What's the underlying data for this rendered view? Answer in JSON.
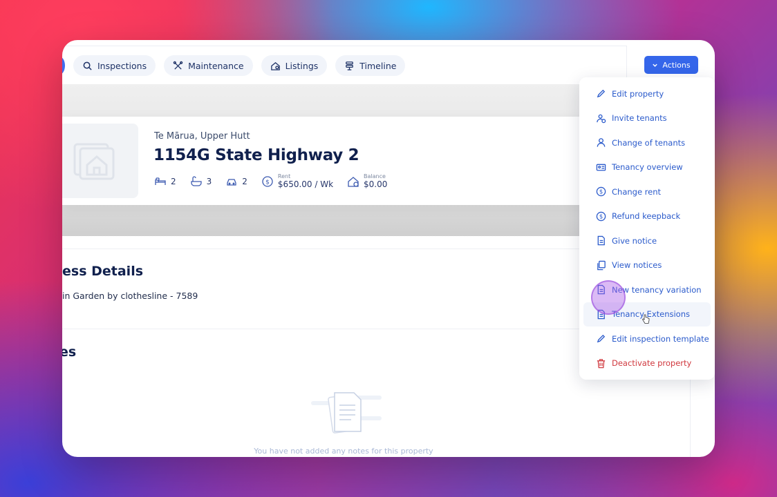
{
  "tabs": [
    {
      "label": "Inspections",
      "icon": "search-icon"
    },
    {
      "label": "Maintenance",
      "icon": "tools-icon"
    },
    {
      "label": "Listings",
      "icon": "house-search-icon"
    },
    {
      "label": "Timeline",
      "icon": "timeline-icon"
    }
  ],
  "actions": {
    "label": "Actions"
  },
  "property": {
    "suburb": "Te Mārua, Upper Hutt",
    "address": "1154G State Highway 2",
    "bedrooms": "2",
    "bathrooms": "3",
    "parking": "2",
    "rent_label": "Rent",
    "rent_value": "$650.00 / Wk",
    "balance_label": "Balance",
    "balance_value": "$0.00"
  },
  "access": {
    "title": "ess Details",
    "text": "in Garden by clothesline - 7589"
  },
  "notes": {
    "title": "es",
    "empty_text": "You have not added any notes for this property"
  },
  "menu": {
    "items": [
      {
        "label": "Edit property",
        "icon": "pencil-icon"
      },
      {
        "label": "Invite tenants",
        "icon": "user-plus-icon"
      },
      {
        "label": "Change of tenants",
        "icon": "user-icon"
      },
      {
        "label": "Tenancy overview",
        "icon": "id-card-icon"
      },
      {
        "label": "Change rent",
        "icon": "dollar-circle-icon"
      },
      {
        "label": "Refund keepback",
        "icon": "dollar-circle-icon"
      },
      {
        "label": "Give notice",
        "icon": "document-icon"
      },
      {
        "label": "View notices",
        "icon": "documents-icon"
      },
      {
        "label": "New tenancy variation",
        "icon": "document-icon"
      },
      {
        "label": "Tenancy Extensions",
        "icon": "document-icon"
      },
      {
        "label": "Edit inspection template",
        "icon": "pencil-icon"
      },
      {
        "label": "Deactivate property",
        "icon": "trash-icon"
      }
    ]
  },
  "colors": {
    "accent": "#3566ea",
    "menu_text": "#2a5acb",
    "danger": "#d0383e",
    "heading": "#10204d"
  }
}
